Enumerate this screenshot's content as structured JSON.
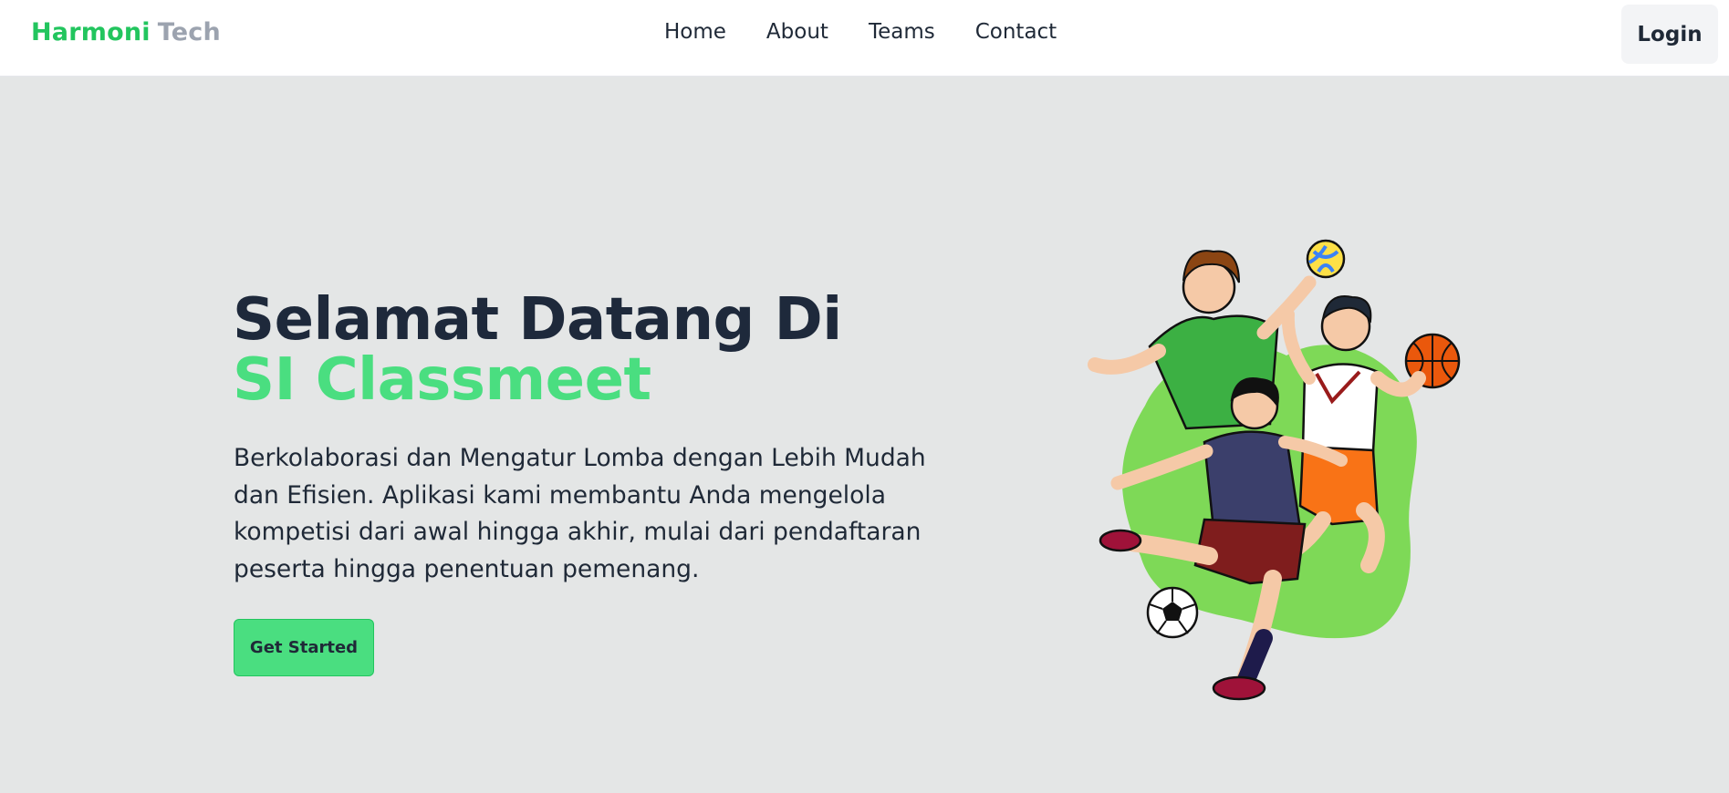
{
  "nav": {
    "brand_primary": "Harmoni",
    "brand_secondary": "Tech",
    "links": [
      "Home",
      "About",
      "Teams",
      "Contact"
    ],
    "login_label": "Login"
  },
  "hero": {
    "title_line1": "Selamat Datang Di",
    "title_line2": "SI Classmeet",
    "description": "Berkolaborasi dan Mengatur Lomba dengan Lebih Mudah dan Efisien. Aplikasi kami membantu Anda mengelola kompetisi dari awal hingga akhir, mulai dari pendaftaran peserta hingga penentuan pemenang.",
    "cta_label": "Get Started"
  },
  "illustration": {
    "icon": "sports-players-illustration",
    "blob_color": "#7ed957"
  },
  "colors": {
    "accent": "#4ade80",
    "brand_green": "#22c55e",
    "background": "#e4e6e6"
  }
}
